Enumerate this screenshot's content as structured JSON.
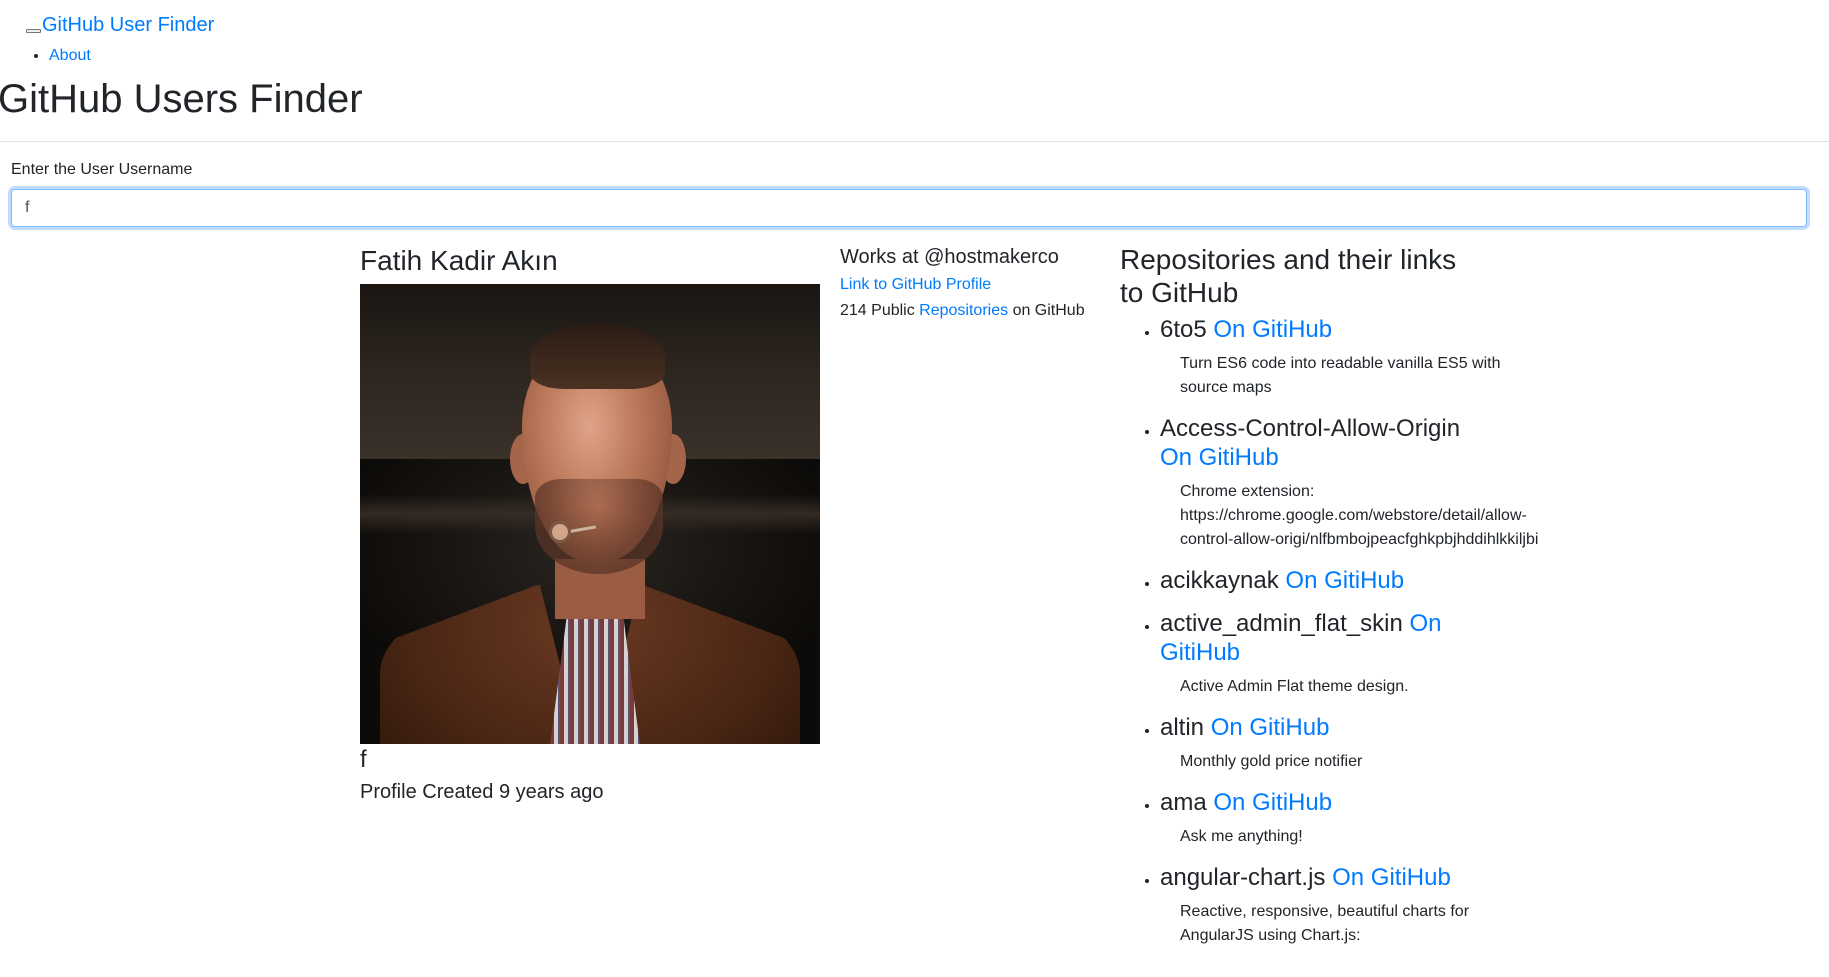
{
  "navbar": {
    "brand": "GitHub User Finder",
    "links": [
      {
        "label": "About"
      }
    ]
  },
  "page_title": "GitHub Users Finder",
  "search": {
    "label": "Enter the User Username",
    "value": "f",
    "placeholder": ""
  },
  "profile": {
    "name": "Fatih Kadir Akın",
    "avatar_alt": "avatar",
    "login": "f",
    "created_text": "Profile Created 9 years ago"
  },
  "info": {
    "company_text": "Works at @hostmakerco",
    "profile_link_label": "Link to GitHub Profile",
    "repo_count_prefix": "214 Public",
    "repo_link_label": "Repositories",
    "repo_count_suffix": "on GitHub"
  },
  "repositories": {
    "title": "Repositories and their links to GitHub",
    "link_label": "On GitiHub",
    "items": [
      {
        "name": "6to5",
        "description": "Turn ES6 code into readable vanilla ES5 with source maps"
      },
      {
        "name": "Access-Control-Allow-Origin",
        "description": "Chrome extension: https://chrome.google.com/webstore/detail/allow-control-allow-origi/nlfbmbojpeacfghkpbjhddihlkkiljbi"
      },
      {
        "name": "acikkaynak",
        "description": ""
      },
      {
        "name": "active_admin_flat_skin",
        "description": "Active Admin Flat theme design."
      },
      {
        "name": "altin",
        "description": "Monthly gold price notifier"
      },
      {
        "name": "ama",
        "description": "Ask me anything!"
      },
      {
        "name": "angular-chart.js",
        "description": "Reactive, responsive, beautiful charts for AngularJS using Chart.js:"
      }
    ]
  },
  "colors": {
    "link": "#007bff",
    "text": "#212529",
    "focus_border": "#80bdff"
  }
}
